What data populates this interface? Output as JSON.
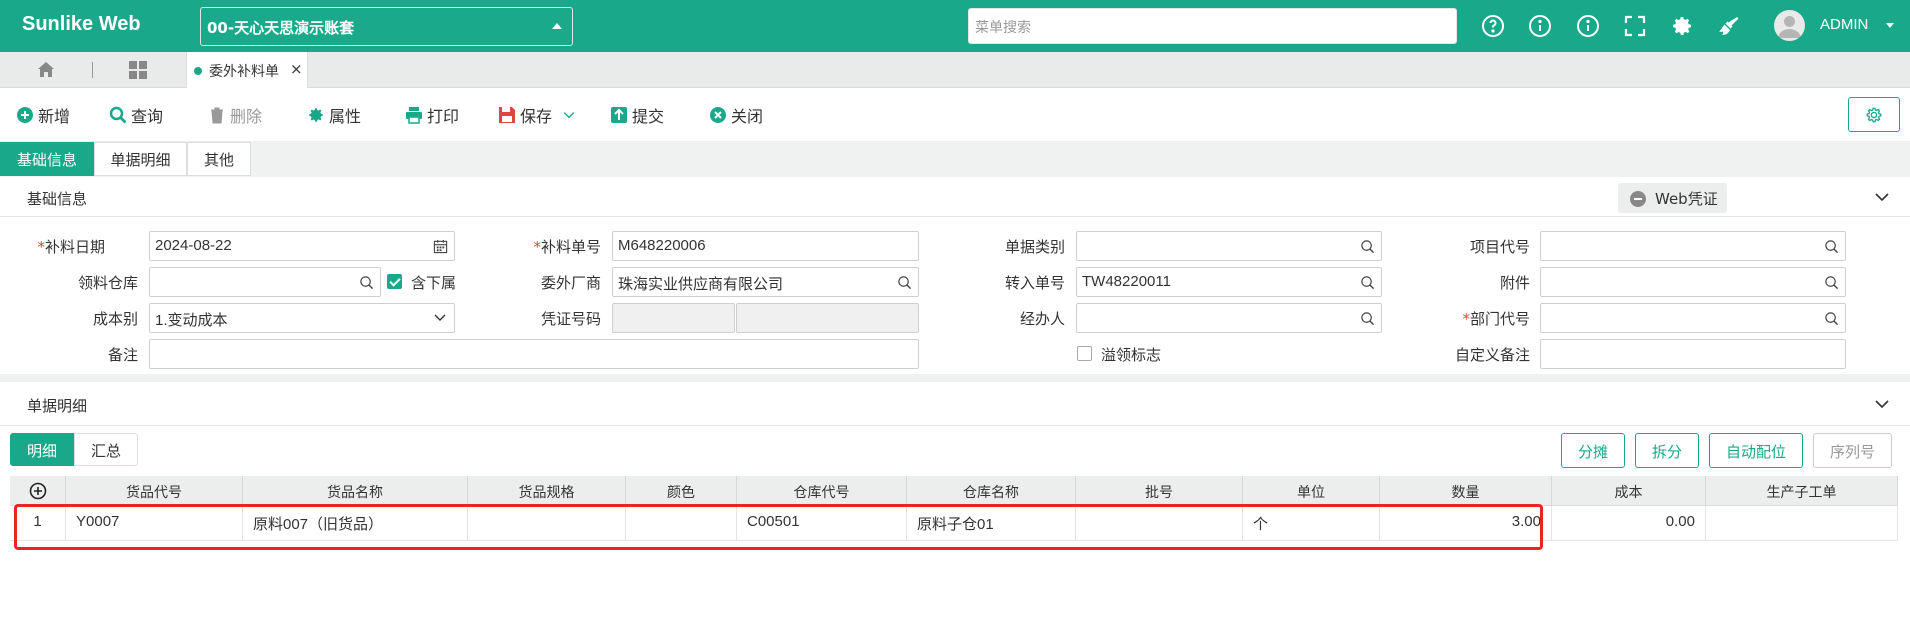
{
  "header": {
    "brand": "Sunlike Web",
    "account": "00-天心天思演示账套",
    "search_placeholder": "菜单搜索",
    "user": "ADMIN"
  },
  "tabs": {
    "current": "委外补料单"
  },
  "toolbar": {
    "add": "新增",
    "query": "查询",
    "delete": "删除",
    "props": "属性",
    "print": "打印",
    "save": "保存",
    "submit": "提交",
    "close": "关闭"
  },
  "section_tabs": [
    "基础信息",
    "单据明细",
    "其他"
  ],
  "basic": {
    "title": "基础信息",
    "web_voucher": "Web凭证",
    "fields": {
      "date_label": "补料日期",
      "date_value": "2024-08-22",
      "no_label": "补料单号",
      "no_value": "M648220006",
      "type_label": "单据类别",
      "type_value": "",
      "project_label": "项目代号",
      "project_value": "",
      "warehouse_label": "领料仓库",
      "warehouse_value": "",
      "include_sub_label": "含下属",
      "vendor_label": "委外厂商",
      "vendor_value": "珠海实业供应商有限公司",
      "transfer_label": "转入单号",
      "transfer_value": "TW48220011",
      "attach_label": "附件",
      "attach_value": "",
      "cost_label": "成本别",
      "cost_value": "1.变动成本",
      "voucher_label": "凭证号码",
      "handler_label": "经办人",
      "handler_value": "",
      "dept_label": "部门代号",
      "dept_value": "",
      "remark_label": "备注",
      "remark_value": "",
      "overflow_label": "溢领标志",
      "custom_remark_label": "自定义备注",
      "custom_remark_value": ""
    }
  },
  "detail": {
    "title": "单据明细",
    "tabs": [
      "明细",
      "汇总"
    ],
    "buttons": [
      "分摊",
      "拆分",
      "自动配位",
      "序列号"
    ],
    "columns": [
      "货品代号",
      "货品名称",
      "货品规格",
      "颜色",
      "仓库代号",
      "仓库名称",
      "批号",
      "单位",
      "数量",
      "成本",
      "生产子工单"
    ],
    "rows": [
      {
        "idx": "1",
        "code": "Y0007",
        "name": "原料007（旧货品）",
        "spec": "",
        "color": "",
        "wh_code": "C00501",
        "wh_name": "原料子仓01",
        "batch": "",
        "unit": "个",
        "qty": "3.00",
        "cost": "0.00",
        "sub_order": ""
      }
    ]
  },
  "colors": {
    "primary": "#19a98a",
    "highlight": "#e8261f"
  }
}
